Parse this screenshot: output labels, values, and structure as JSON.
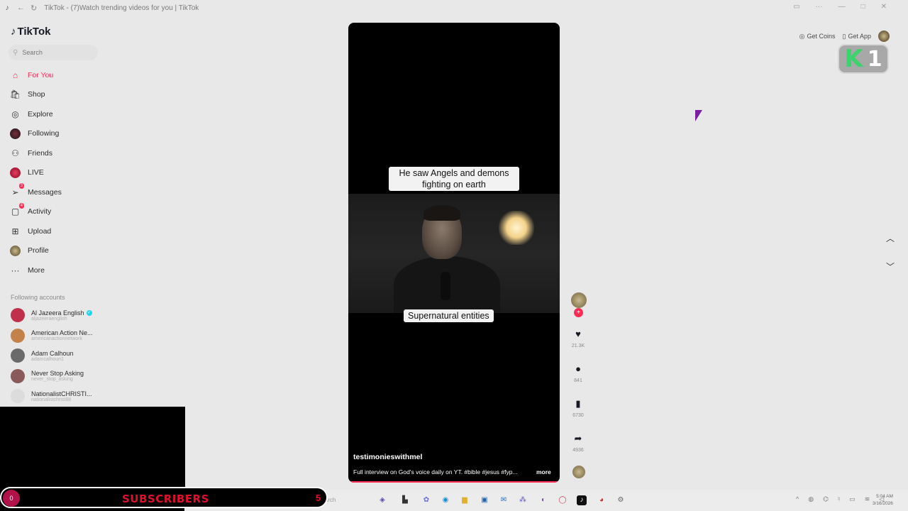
{
  "window": {
    "title": "TikTok - (7)Watch trending videos for you | TikTok"
  },
  "sidebar": {
    "logo": "TikTok",
    "search_placeholder": "Search",
    "nav": [
      {
        "label": "For You",
        "icon": "home-icon",
        "active": true
      },
      {
        "label": "Shop",
        "icon": "shopping-bag-icon"
      },
      {
        "label": "Explore",
        "icon": "compass-icon"
      },
      {
        "label": "Following",
        "icon": "avatar-icon"
      },
      {
        "label": "Friends",
        "icon": "friends-icon"
      },
      {
        "label": "LIVE",
        "icon": "live-icon"
      },
      {
        "label": "Messages",
        "icon": "send-icon",
        "badge": "3"
      },
      {
        "label": "Activity",
        "icon": "activity-icon",
        "badge": "4"
      },
      {
        "label": "Upload",
        "icon": "plus-box-icon"
      },
      {
        "label": "Profile",
        "icon": "avatar-icon"
      },
      {
        "label": "More",
        "icon": "ellipsis-icon"
      }
    ],
    "following_title": "Following accounts",
    "accounts": [
      {
        "name": "Al Jazeera English",
        "handle": "aljazeeraenglish",
        "verified": true,
        "color": "#c0304a"
      },
      {
        "name": "American Action Ne...",
        "handle": "americanactionnetwork",
        "color": "#c4824a"
      },
      {
        "name": "Adam Calhoun",
        "handle": "adamcalhoun1",
        "color": "#6a6a6a"
      },
      {
        "name": "Never Stop Asking",
        "handle": "never_stop_asking",
        "color": "#8a5a5a"
      },
      {
        "name": "NationalistCHRISTI...",
        "handle": "nationalistchrist88",
        "color": "#dcdcdc"
      }
    ]
  },
  "video": {
    "caption_top": "He saw Angels and demons fighting on earth",
    "caption_bottom": "Supernatural entities",
    "author": "testimonieswithmel",
    "description": "Full interview on God's voice daily on YT. #bible #jesus #fyp...",
    "more_label": "more"
  },
  "actions": {
    "likes": "21.3K",
    "comments": "841",
    "saves": "6730",
    "shares": "4936"
  },
  "topbar": {
    "get_coins": "Get Coins",
    "get_app": "Get App"
  },
  "overlay": {
    "k_letter": "K",
    "k_number": "1",
    "subscribers_label": "SUBSCRIBERS",
    "subscribers_count": "5",
    "sub_logo": "0"
  },
  "taskbar": {
    "search_label": "Search",
    "time": "5:04 AM",
    "date": "3/16/2026"
  },
  "colors": {
    "accent": "#fe2c55",
    "background": "#e8e8e8",
    "k_green": "#3bd36b",
    "subscribers_red": "#e0102c"
  }
}
